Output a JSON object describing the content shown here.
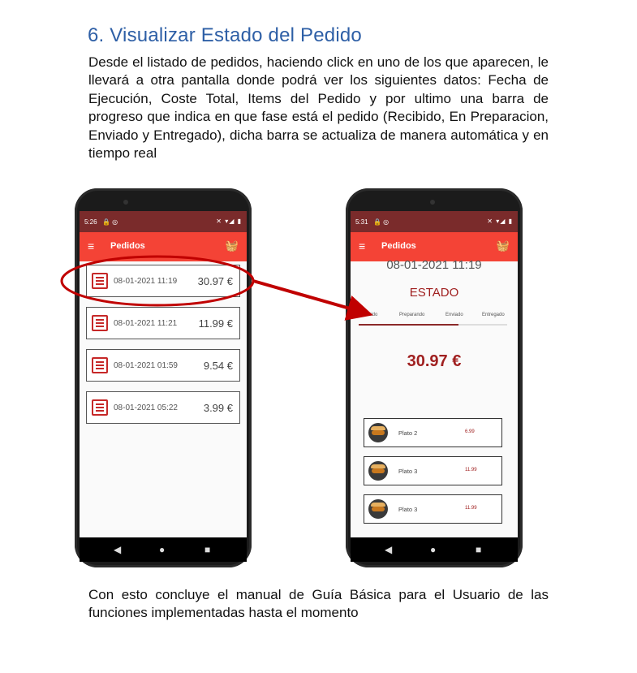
{
  "heading": "6. Visualizar Estado del Pedido",
  "paragraph1": "Desde el listado de pedidos, haciendo click en uno de los que aparecen, le llevará a otra pantalla donde podrá ver los siguientes datos: Fecha de Ejecución, Coste Total, Items del Pedido y por ultimo una barra de progreso que indica en que fase está el pedido (Recibido, En Preparacion, Enviado y Entregado), dicha barra se actualiza de manera automática y en tiempo real",
  "paragraph2": "Con esto concluye el manual de Guía Básica para el Usuario de las funciones implementadas hasta el momento",
  "colors": {
    "appbar": "#f44336",
    "statusbar": "#7a2b2b",
    "accent": "#a02020",
    "callout": "#c00000"
  },
  "phone1": {
    "status_time": "5:26",
    "status_left_icons": "🔒 ◎",
    "status_right_icons": "✕ ▾◢ ▮",
    "appbar_title": "Pedidos",
    "menu_icon": "≡",
    "basket_icon": "🧺",
    "orders": [
      {
        "date": "08-01-2021 11:19",
        "price": "30.97 €"
      },
      {
        "date": "08-01-2021 11:21",
        "price": "11.99 €"
      },
      {
        "date": "08-01-2021 01:59",
        "price": "9.54 €"
      },
      {
        "date": "08-01-2021 05:22",
        "price": "3.99 €"
      }
    ],
    "nav": {
      "back": "◀",
      "home": "●",
      "recent": "■"
    }
  },
  "phone2": {
    "status_time": "5:31",
    "status_left_icons": "🔒 ◎",
    "status_right_icons": "✕ ▾◢ ▮",
    "appbar_title": "Pedidos",
    "menu_icon": "≡",
    "basket_icon": "🧺",
    "date": "08-01-2021 11:19",
    "estado_label": "ESTADO",
    "steps": [
      "Recibido",
      "Preparando",
      "Enviado",
      "Entregado"
    ],
    "progress_fraction": 0.67,
    "total": "30.97 €",
    "items": [
      {
        "name": "Plato 2",
        "price": "6.99"
      },
      {
        "name": "Plato 3",
        "price": "11.99"
      },
      {
        "name": "Plato 3",
        "price": "11.99"
      }
    ],
    "nav": {
      "back": "◀",
      "home": "●",
      "recent": "■"
    }
  }
}
